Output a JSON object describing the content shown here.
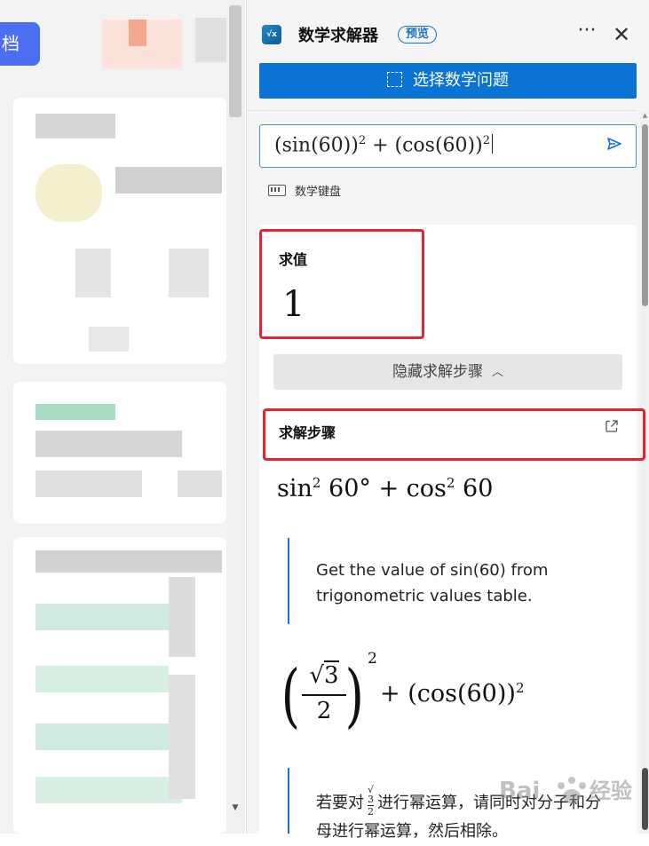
{
  "left_pane": {
    "button_label": "档"
  },
  "app": {
    "title": "数学求解器",
    "badge": "预览",
    "more_label": "···",
    "close_label": "✕",
    "accent": "#0a74d4"
  },
  "select_button": {
    "label": "选择数学问题"
  },
  "input": {
    "expression_part1": "(sin(60))",
    "sup1": "2",
    "plus": " + ",
    "expression_part2": "(cos(60))",
    "sup2": "2"
  },
  "keyboard": {
    "label": "数学键盘"
  },
  "result": {
    "label": "求值",
    "value": "1"
  },
  "hide_steps": {
    "label": "隐藏求解步骤"
  },
  "steps": {
    "label": "求解步骤",
    "step1": {
      "sin": "sin",
      "sup_a": "2",
      "mid": " 60° + cos",
      "sup_b": "2",
      "end": " 60"
    },
    "explanation1": "Get the value of sin(60) from trigonometric values table.",
    "step2": {
      "num": "3",
      "den": "2",
      "outer_sup": "2",
      "rest": "+ (cos(60))",
      "rest_sup": "2"
    },
    "explanation2_pre": "若要对",
    "explanation2_post": "进行幂运算，请同时对分子和分母进行幂运算，然后相除。"
  },
  "highlight_color": "#e3262b",
  "watermark": "Bai经验"
}
